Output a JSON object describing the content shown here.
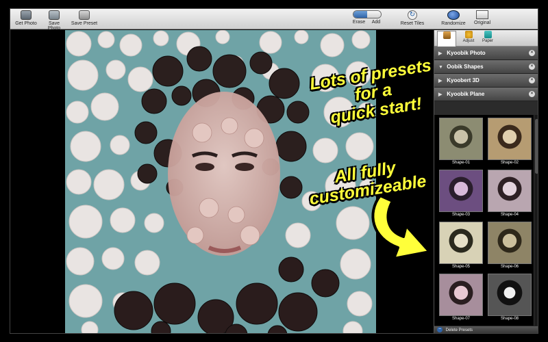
{
  "toolbar": {
    "get_photo": "Get Photo",
    "save_photo": "Save Photo",
    "save_preset": "Save Preset",
    "erase": "Erase",
    "add": "Add",
    "reset_tiles": "Reset Tiles",
    "randomize": "Randomize",
    "original": "Original"
  },
  "callouts": {
    "line1": "Lots of presets",
    "line2": "for a",
    "line3": "quick start!",
    "line4": "All fully",
    "line5": "customizeable"
  },
  "panel": {
    "tabs": [
      "",
      "Adjust",
      "Paper"
    ],
    "groups": [
      {
        "label": "Kyoobik Photo",
        "expanded": false
      },
      {
        "label": "Oobik Shapes",
        "expanded": true
      },
      {
        "label": "Kyoobert 3D",
        "expanded": false
      },
      {
        "label": "Kyoobik Plane",
        "expanded": false
      }
    ],
    "thumbnails": [
      "Shape-01",
      "Shape-02",
      "Shape-03",
      "Shape-04",
      "Shape-05",
      "Shape-06",
      "Shape-07",
      "Shape-08"
    ],
    "footer": "Delete Presets"
  },
  "colors": {
    "callout": "#ffff3a",
    "canvas_bg": "#6fa3a6",
    "accent": "#2f64a8"
  }
}
